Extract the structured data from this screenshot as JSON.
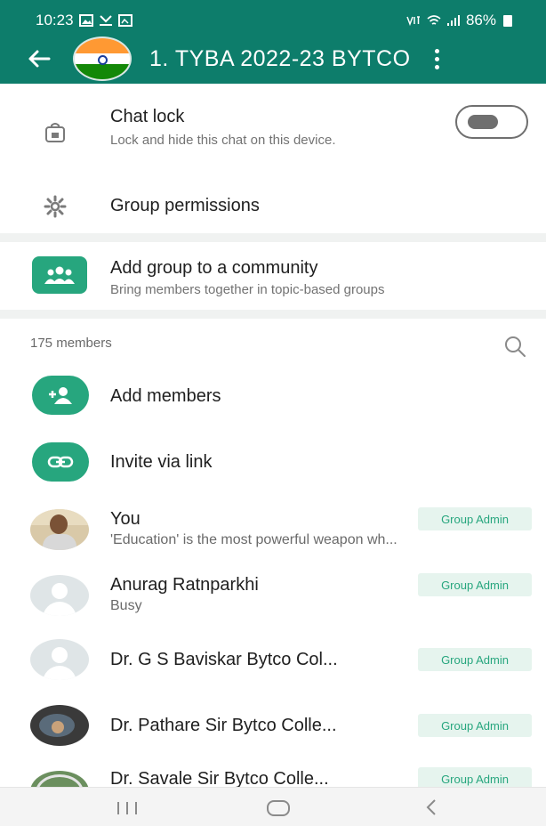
{
  "status_bar": {
    "time": "10:23",
    "left_icons": [
      "gallery-icon",
      "missed-call-icon",
      "image-icon"
    ],
    "right_icons": [
      "volte-icon",
      "wifi-icon",
      "signal-icon"
    ],
    "battery": "86%"
  },
  "app_bar": {
    "title": "1. TYBA  2022-23 BYTCO",
    "back_icon": "arrow-left-icon",
    "menu_icon": "more-vertical-icon",
    "accent_color": "#0d7d6b"
  },
  "settings": {
    "chat_lock": {
      "title": "Chat lock",
      "subtitle": "Lock and hide this chat on this device.",
      "icon": "chat-lock-icon",
      "enabled": false
    },
    "group_permissions": {
      "title": "Group permissions",
      "icon": "gear-icon"
    }
  },
  "community": {
    "title": "Add group to a community",
    "subtitle": "Bring members together in topic-based groups",
    "icon": "community-icon"
  },
  "members": {
    "count_label": "175 members",
    "search_icon": "search-icon",
    "actions": [
      {
        "label": "Add members",
        "icon": "add-person-icon"
      },
      {
        "label": "Invite via link",
        "icon": "link-icon"
      }
    ],
    "list": [
      {
        "name": "You",
        "status": "'Education' is the most powerful weapon wh...",
        "badge": "Group Admin"
      },
      {
        "name": "Anurag Ratnparkhi",
        "status": "Busy",
        "badge": "Group Admin"
      },
      {
        "name": "Dr. G S Baviskar Bytco Col...",
        "status": "",
        "badge": "Group Admin"
      },
      {
        "name": "Dr. Pathare Sir Bytco Colle...",
        "status": "",
        "badge": "Group Admin"
      },
      {
        "name": "Dr. Savale Sir Bytco Colle...",
        "status": "",
        "badge": "Group Admin"
      }
    ],
    "badge_color": "#27a67e"
  },
  "nav_bar": {
    "icons": [
      "recents-icon",
      "home-icon",
      "back-icon"
    ]
  }
}
